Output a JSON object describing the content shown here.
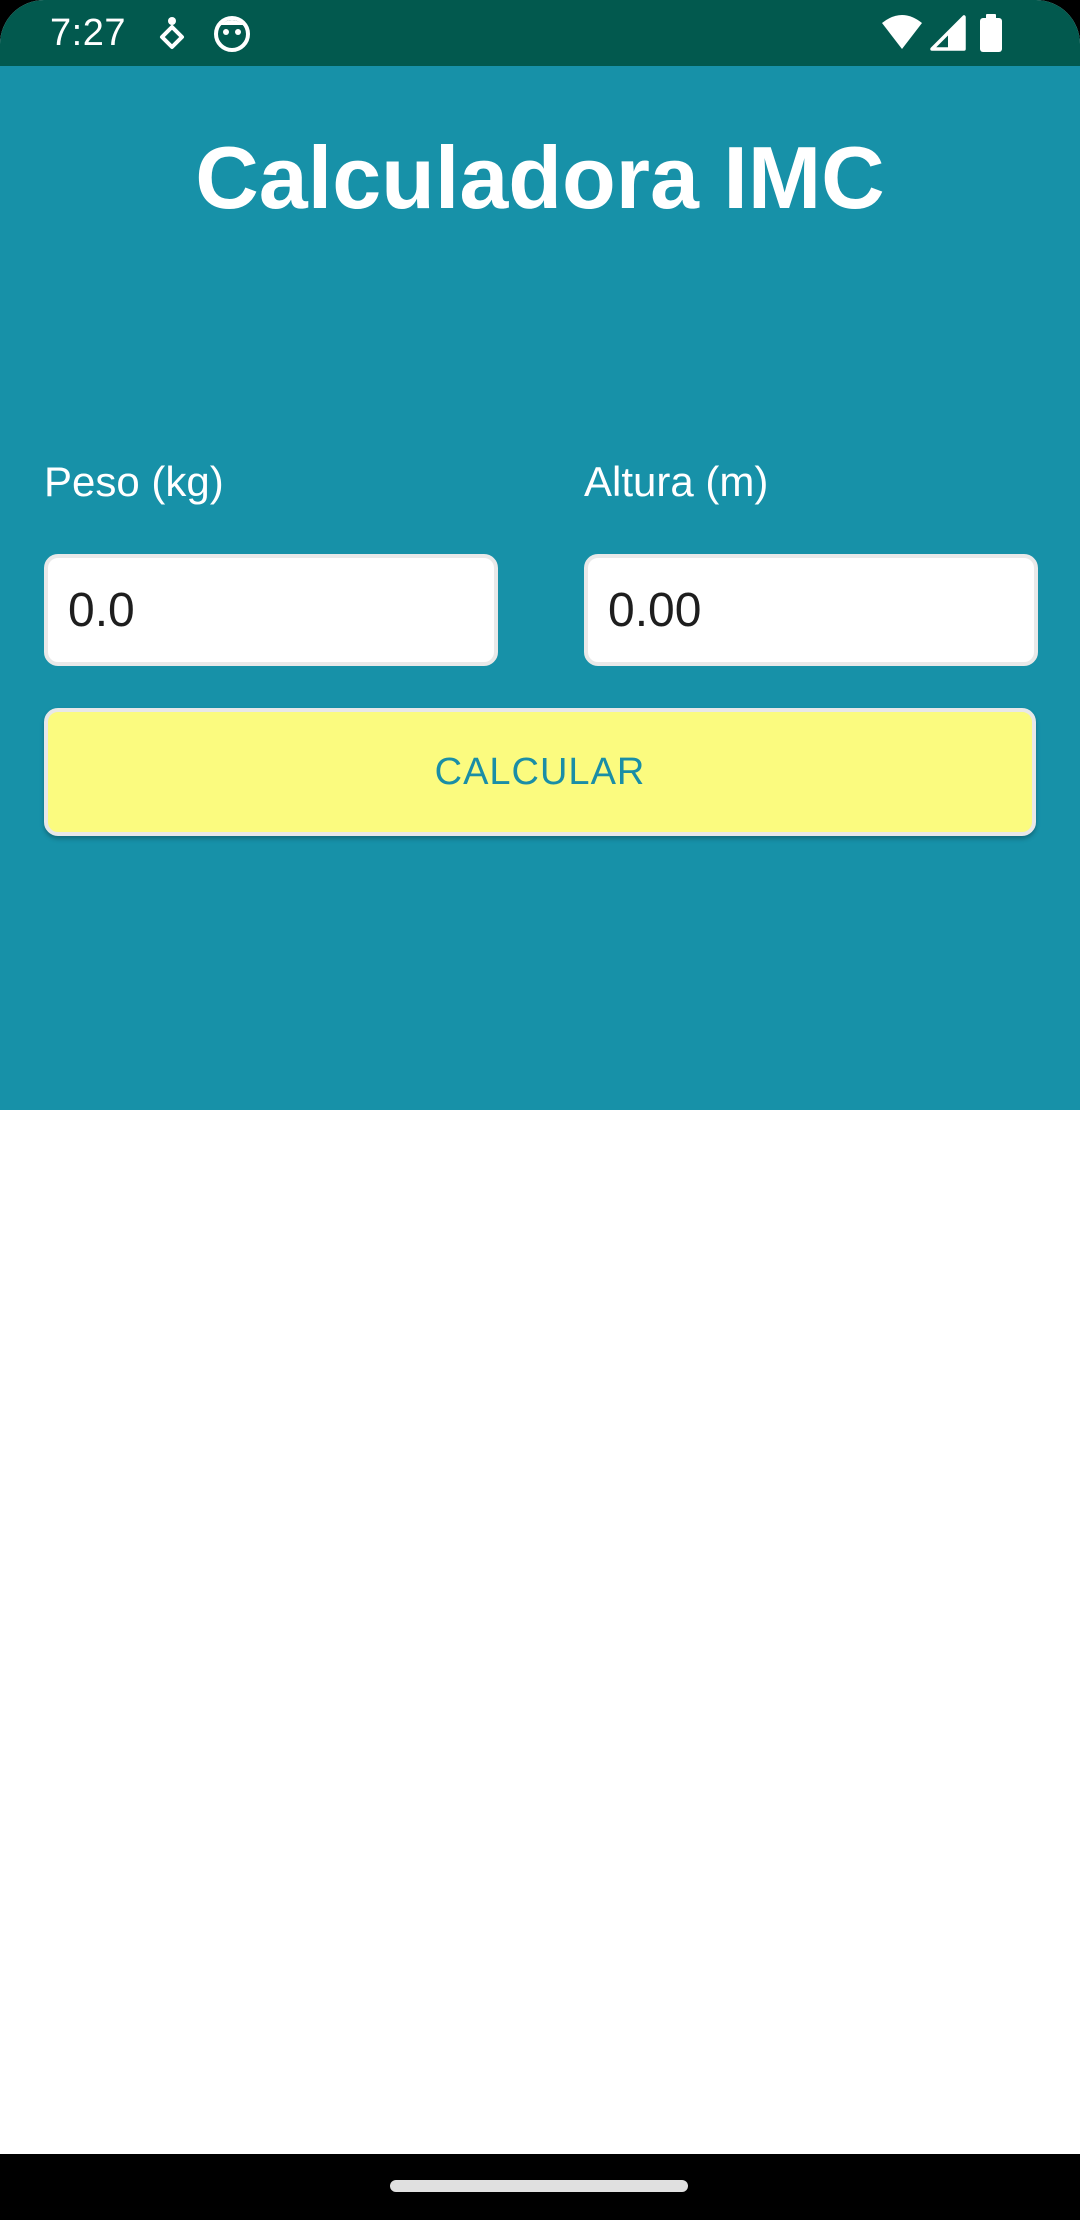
{
  "status_bar": {
    "time": "7:27",
    "left_icons": [
      "accessibility-icon",
      "face-icon"
    ],
    "right_icons": [
      "wifi-icon",
      "cell-signal-icon",
      "battery-icon"
    ],
    "background_color": "#02594e"
  },
  "app": {
    "title": "Calculadora IMC",
    "panel_color": "#1791a8",
    "weight": {
      "label": "Peso (kg)",
      "value": "0.0"
    },
    "height": {
      "label": "Altura (m)",
      "value": "0.00"
    },
    "calculate_button": {
      "label": "CALCULAR",
      "background_color": "#fbfb7f",
      "text_color": "#1a8ea6"
    }
  },
  "nav_bar": {
    "home_indicator": "home-handle"
  }
}
